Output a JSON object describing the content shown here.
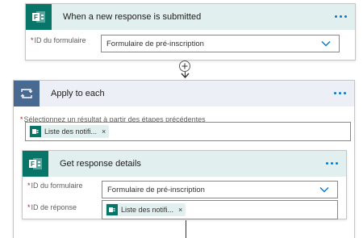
{
  "trigger": {
    "title": "When a new response is submitted",
    "form_id_label": "ID du formulaire",
    "form_value": "Formulaire de pré-inscription"
  },
  "apply_each": {
    "title": "Apply to each",
    "select_label": "Sélectionnez un résultat à partir des étapes précédentes",
    "token_label": "Liste des notifi...",
    "token_close": "×"
  },
  "get_details": {
    "title": "Get response details",
    "form_id_label": "ID du formulaire",
    "form_value": "Formulaire de pré-inscription",
    "response_id_label": "ID de réponse",
    "token_label": "Liste des notifi...",
    "token_close": "×"
  },
  "required_marker": "*",
  "colors": {
    "forms_green": "#077568",
    "forms_header_bg": "#e1f0ee",
    "loop_blue": "#486991",
    "loop_header_bg": "#ecf0f6",
    "accent": "#0078d4"
  },
  "icons": {
    "forms": "forms-icon",
    "loop": "loop-icon",
    "more": "more-icon",
    "chevron": "chevron-down-icon",
    "add": "plus-icon"
  }
}
